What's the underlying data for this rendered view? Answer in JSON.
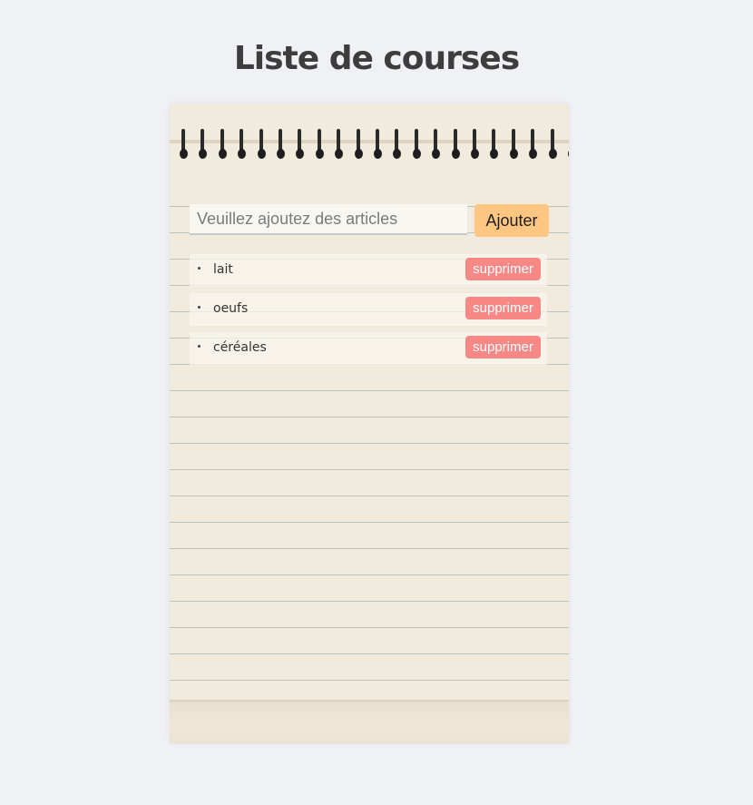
{
  "page": {
    "title": "Liste de courses"
  },
  "form": {
    "placeholder": "Veuillez ajoutez des articles",
    "value": "",
    "add_label": "Ajouter"
  },
  "items": [
    {
      "label": "lait",
      "delete_label": "supprimer"
    },
    {
      "label": "oeufs",
      "delete_label": "supprimer"
    },
    {
      "label": "céréales",
      "delete_label": "supprimer"
    }
  ],
  "colors": {
    "background": "#f0f1f5",
    "paper": "#f1ebde",
    "add_button": "#fec781",
    "delete_button": "#f78886",
    "title": "#3d3d3d"
  },
  "icons": {
    "binding": "spiral-binding",
    "bullet": "bullet-dot-icon"
  }
}
